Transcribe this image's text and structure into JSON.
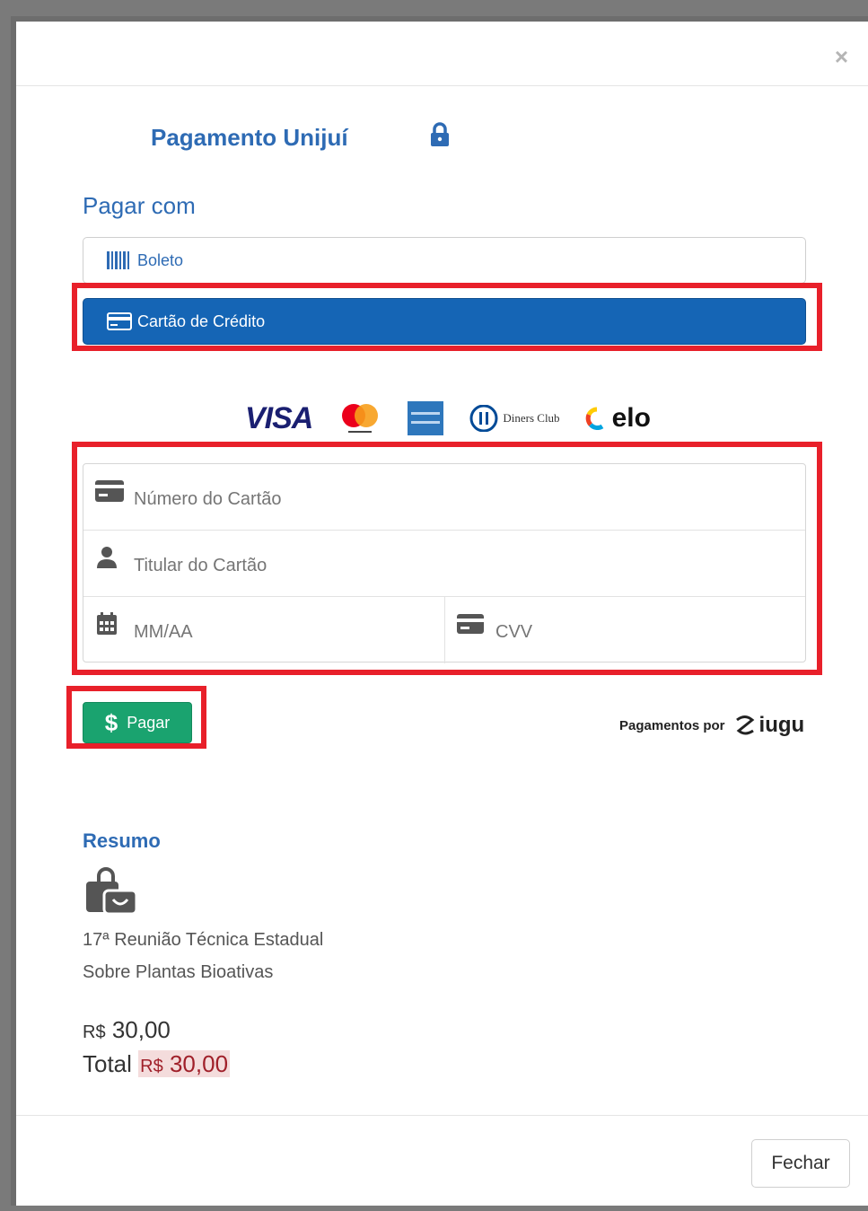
{
  "modal": {
    "close_symbol": "×",
    "title": "Pagamento Unijuí",
    "pay_with": "Pagar com"
  },
  "methods": {
    "boleto_label": "Boleto",
    "card_label": "Cartão de Crédito"
  },
  "brands": {
    "visa": "VISA",
    "diners": "Diners Club",
    "elo": "elo"
  },
  "form": {
    "card_number_placeholder": "Número do Cartão",
    "holder_placeholder": "Titular do Cartão",
    "expiry_placeholder": "MM/AA",
    "cvv_placeholder": "CVV"
  },
  "actions": {
    "pay_symbol": "$",
    "pay_label": "Pagar",
    "powered_by": "Pagamentos por",
    "provider": "iugu"
  },
  "summary": {
    "title": "Resumo",
    "item_name": "17ª Reunião Técnica Estadual Sobre Plantas Bioativas",
    "currency": "R$",
    "price": "30,00",
    "total_label": "Total",
    "total_value": "30,00"
  },
  "footer": {
    "close_label": "Fechar"
  },
  "colors": {
    "primary": "#2e6bb4",
    "card_button": "#1565b5",
    "pay_button": "#1aa36f",
    "highlight": "#e8202a"
  }
}
